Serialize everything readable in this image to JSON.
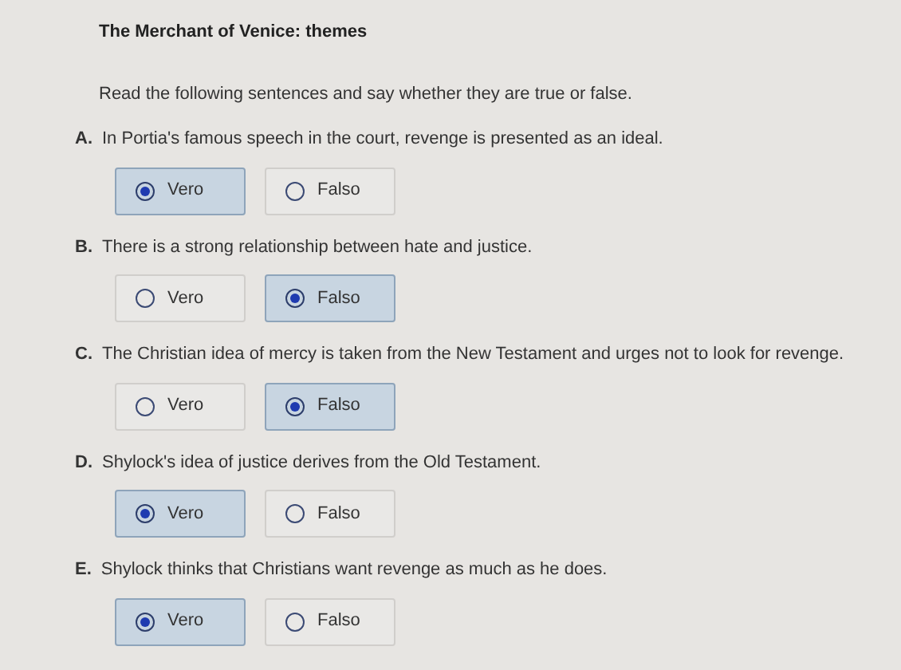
{
  "title": "The Merchant of Venice: themes",
  "instruction": "Read the following sentences and say whether they are true or false.",
  "questions": [
    {
      "letter": "A.",
      "text": "In Portia's famous speech in the court, revenge is presented as an ideal.",
      "options": [
        {
          "label": "Vero",
          "selected": true
        },
        {
          "label": "Falso",
          "selected": false
        }
      ]
    },
    {
      "letter": "B.",
      "text": "There is a strong relationship between hate and justice.",
      "options": [
        {
          "label": "Vero",
          "selected": false
        },
        {
          "label": "Falso",
          "selected": true
        }
      ]
    },
    {
      "letter": "C.",
      "text": "The Christian idea of mercy is taken from the New Testament and urges not to look for revenge.",
      "options": [
        {
          "label": "Vero",
          "selected": false
        },
        {
          "label": "Falso",
          "selected": true
        }
      ]
    },
    {
      "letter": "D.",
      "text": "Shylock's idea of justice derives from the Old Testament.",
      "options": [
        {
          "label": "Vero",
          "selected": true
        },
        {
          "label": "Falso",
          "selected": false
        }
      ]
    },
    {
      "letter": "E.",
      "text": "Shylock thinks that Christians want revenge as much as he does.",
      "options": [
        {
          "label": "Vero",
          "selected": true
        },
        {
          "label": "Falso",
          "selected": false
        }
      ]
    }
  ]
}
